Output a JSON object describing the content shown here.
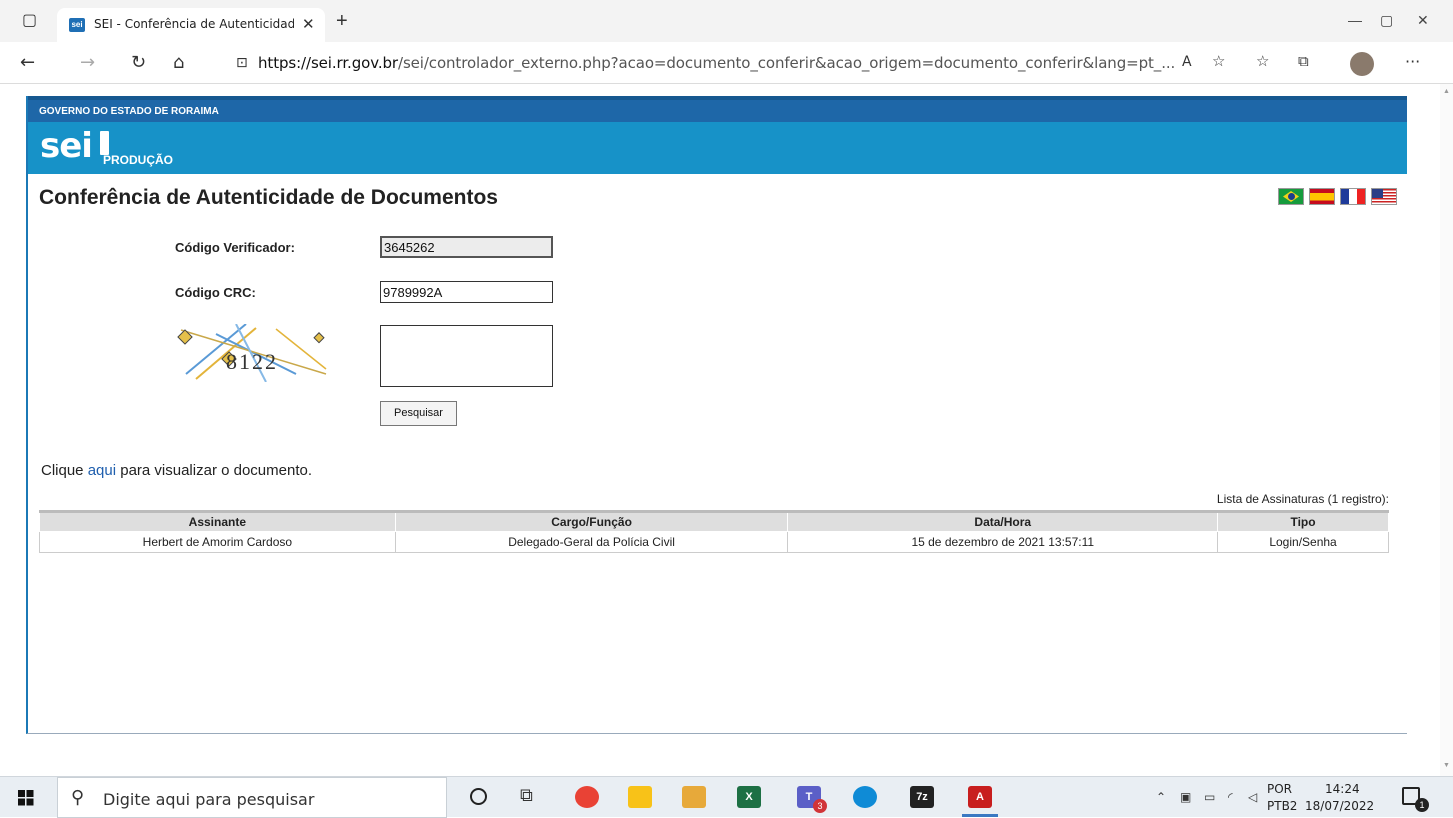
{
  "browser": {
    "tab_title": "SEI - Conferência de Autenticidade",
    "favicon_text": "sei",
    "url_host": "https://sei.rr.gov.br",
    "url_path": "/sei/controlador_externo.php?acao=documento_conferir&acao_origem=documento_conferir&lang=pt_..."
  },
  "header": {
    "government": "GOVERNO DO ESTADO DE RORAIMA",
    "logo": "sei",
    "environment": "PRODUÇÃO"
  },
  "page": {
    "title": "Conferência de Autenticidade de Documentos",
    "flags": [
      "brazil-flag-icon",
      "spain-flag-icon",
      "france-flag-icon",
      "usa-flag-icon"
    ]
  },
  "form": {
    "verifier_label": "Código Verificador:",
    "verifier_value": "3645262",
    "crc_label": "Código CRC:",
    "crc_value": "9789992A",
    "captcha_text": "8122",
    "captcha_answer": "",
    "search_button": "Pesquisar"
  },
  "result": {
    "prefix": "Clique ",
    "link": "aqui",
    "suffix": " para visualizar o documento."
  },
  "signatures": {
    "caption": "Lista de Assinaturas (1 registro):",
    "headers": [
      "Assinante",
      "Cargo/Função",
      "Data/Hora",
      "Tipo"
    ],
    "rows": [
      [
        "Herbert de Amorim Cardoso",
        "Delegado-Geral da Polícia Civil",
        "15 de dezembro de 2021 13:57:11",
        "Login/Senha"
      ]
    ]
  },
  "taskbar": {
    "search_placeholder": "Digite aqui para pesquisar",
    "lang": "POR",
    "layout": "PTB2",
    "time": "14:24",
    "date": "18/07/2022",
    "teams_badge": "3",
    "notification_count": "1"
  },
  "colors": {
    "gov_bar": "#1e67a8",
    "sei_bar": "#1792c8",
    "link": "#1f5fae"
  }
}
